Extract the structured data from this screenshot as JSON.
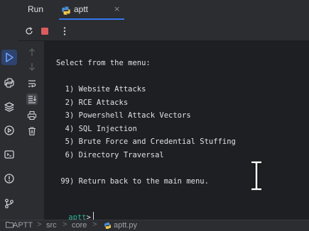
{
  "header": {
    "run_title": "Run",
    "tab": {
      "label": "aptt",
      "icon": "python-file-icon",
      "close": "×"
    }
  },
  "toolbar": {
    "rerun_icon": "rerun-icon",
    "stop_icon": "stop-icon",
    "more_icon": "more-options-icon",
    "stop_color": "#db5c5c"
  },
  "console": {
    "lines": [
      "Select from the menu:",
      "",
      "  1) Website Attacks",
      "  2) RCE Attacks",
      "  3) Powershell Attack Vectors",
      "  4) SQL Injection",
      "  5) Brute Force and Credential Stuffing",
      "  6) Directory Traversal",
      "",
      " 99) Return back to the main menu."
    ],
    "prompt_name": "aptt",
    "prompt_symbol": ">"
  },
  "status": {
    "breadcrumbs": [
      "APTT",
      "src",
      "core",
      "aptt.py"
    ],
    "separator": ">"
  },
  "colors": {
    "accent": "#3574f0",
    "prompt": "#2fb39a",
    "background": "#1e1f22",
    "panel": "#2b2d30"
  }
}
